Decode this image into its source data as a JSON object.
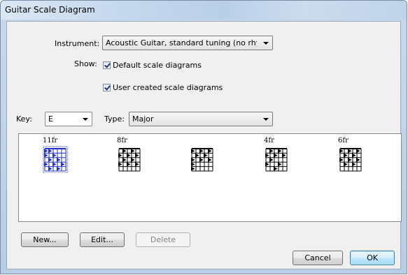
{
  "window": {
    "title": "Guitar Scale Diagram"
  },
  "instrument": {
    "label": "Instrument:",
    "value": "Acoustic Guitar, standard tuning (no rhythms"
  },
  "show": {
    "label": "Show:",
    "default_diagrams": {
      "label": "Default scale diagrams",
      "checked": true
    },
    "user_diagrams": {
      "label": "User created scale diagrams",
      "checked": true
    }
  },
  "key": {
    "label": "Key:",
    "value": "E"
  },
  "type": {
    "label": "Type:",
    "value": "Major"
  },
  "diagrams": [
    {
      "fret": "11fr",
      "selected": true,
      "color": "#1f2fd0"
    },
    {
      "fret": "8fr",
      "selected": false,
      "color": "#000000"
    },
    {
      "fret": "",
      "selected": false,
      "color": "#000000"
    },
    {
      "fret": "4fr",
      "selected": false,
      "color": "#000000"
    },
    {
      "fret": "6fr",
      "selected": false,
      "color": "#000000"
    }
  ],
  "buttons": {
    "new": "New...",
    "edit": "Edit...",
    "delete": "Delete",
    "cancel": "Cancel",
    "ok": "OK"
  }
}
